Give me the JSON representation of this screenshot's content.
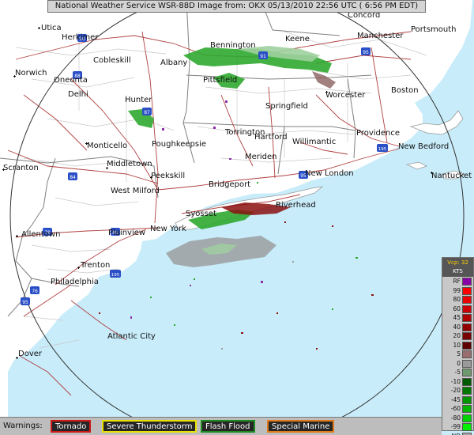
{
  "title": "National Weather Service WSR-88D Image from: OKX 05/13/2010 22:56 UTC ( 6:56 PM EDT)",
  "colors": {
    "land": "#ffffff",
    "ocean": "#c8ecfa",
    "state_border": "#808080",
    "county_border": "#c8c8c8",
    "road": "#b04040",
    "interstate_shield": "#2a4fc6",
    "range_ring": "#333333",
    "echo_inbound": "#2fa82f",
    "echo_light_inbound": "#9fd09f",
    "echo_rf": "#8a2fa8",
    "echo_zero": "#9a9a9a",
    "echo_outbound": "#8b1010"
  },
  "cities": [
    "Utica",
    "Herkimer",
    "Concord",
    "Bennington",
    "Keene",
    "Manchester",
    "Portsmouth",
    "Cobleskill",
    "Albany",
    "Norwich",
    "Oneonta",
    "Delhi",
    "Pittsfield",
    "Worcester",
    "Boston",
    "Springfield",
    "Hunter",
    "Torrington",
    "Hartford",
    "Willimantic",
    "Providence",
    "New Bedford",
    "Monticello",
    "Poughkeepsie",
    "Meriden",
    "Scranton",
    "Middletown",
    "Peekskill",
    "New London",
    "Nantucket",
    "West Milford",
    "Bridgeport",
    "Riverhead",
    "Syosset",
    "Allentown",
    "Plainview",
    "New York",
    "Trenton",
    "Philadelphia",
    "Atlantic City",
    "Dover"
  ],
  "interstates": [
    "90",
    "88",
    "87",
    "91",
    "84",
    "95",
    "80",
    "78",
    "76",
    "195"
  ],
  "legend": {
    "vcp_label": "Vcp: 32",
    "units": "KTS",
    "items": [
      {
        "label": "RF",
        "color": "#8a00a8"
      },
      {
        "label": "99",
        "color": "#ff0000"
      },
      {
        "label": "80",
        "color": "#e80000"
      },
      {
        "label": "60",
        "color": "#cc0000"
      },
      {
        "label": "45",
        "color": "#b00000"
      },
      {
        "label": "40",
        "color": "#900000"
      },
      {
        "label": "20",
        "color": "#780000"
      },
      {
        "label": "10",
        "color": "#5e0000"
      },
      {
        "label": "5",
        "color": "#9a6e6e"
      },
      {
        "label": "0",
        "color": "#9a9a9a"
      },
      {
        "label": "-5",
        "color": "#6e9a6e"
      },
      {
        "label": "-10",
        "color": "#005a00"
      },
      {
        "label": "-20",
        "color": "#007800"
      },
      {
        "label": "-45",
        "color": "#009600"
      },
      {
        "label": "-60",
        "color": "#00b400"
      },
      {
        "label": "-80",
        "color": "#00d200"
      },
      {
        "label": "-99",
        "color": "#00f000"
      },
      {
        "label": "ND",
        "color": "#a6a6a6"
      }
    ]
  },
  "warnings": {
    "label": "Warnings:",
    "items": [
      {
        "label": "Tornado",
        "color": "#cc1a1a"
      },
      {
        "label": "Severe Thunderstorm",
        "color": "#e8e000"
      },
      {
        "label": "Flash Flood",
        "color": "#1f8a1f"
      },
      {
        "label": "Special Marine",
        "color": "#e07a1a"
      }
    ]
  }
}
